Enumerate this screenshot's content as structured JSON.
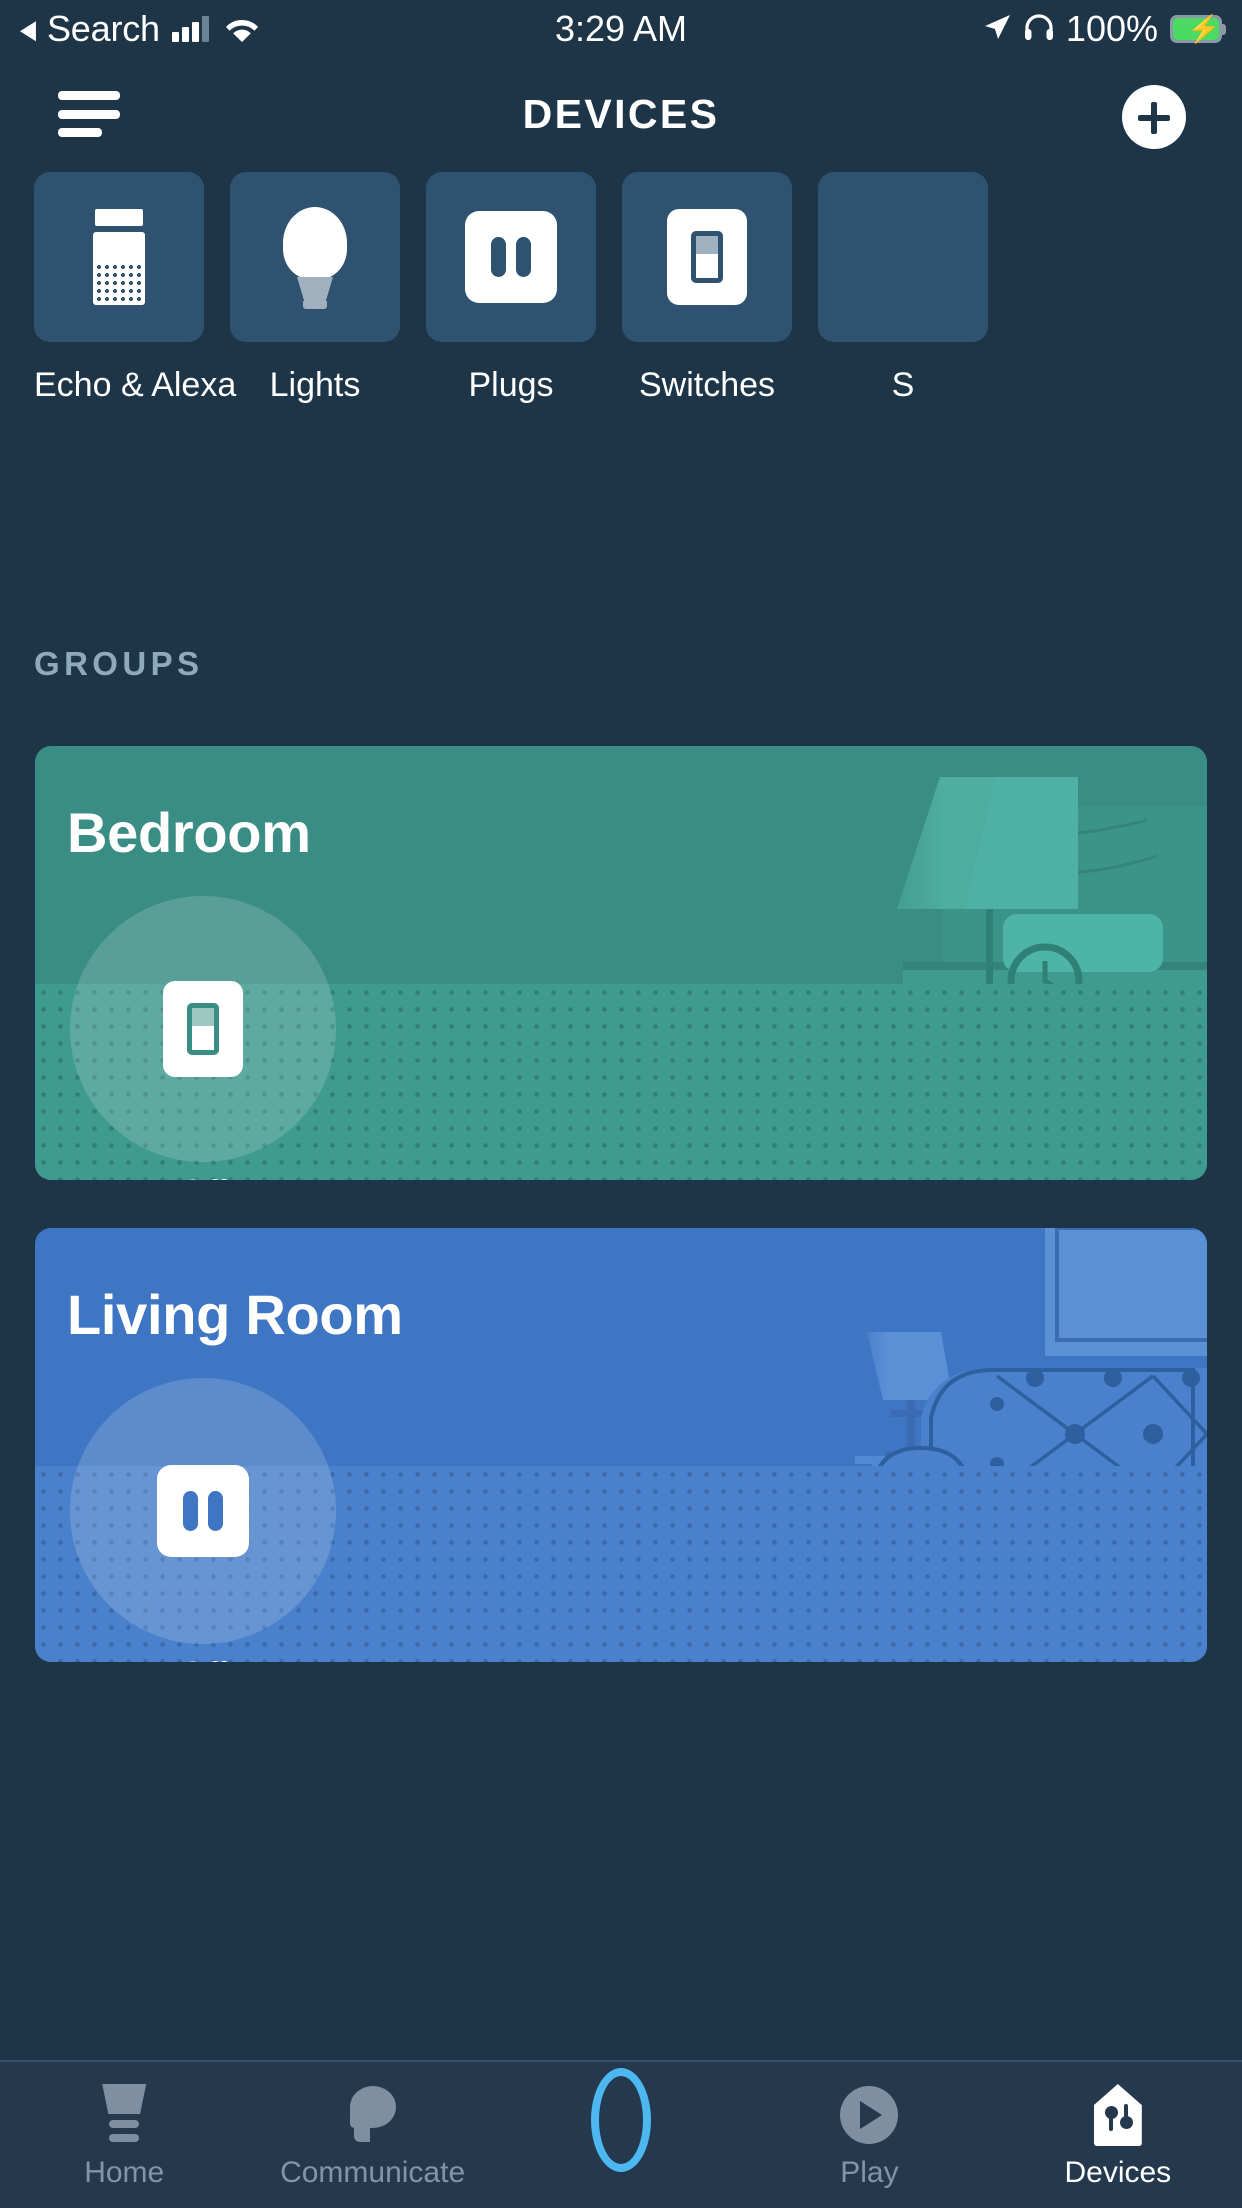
{
  "status_bar": {
    "back_label": "Search",
    "back_arrow_icon": "triangle-left-icon",
    "signal_icon": "cellular-signal-icon",
    "wifi_icon": "wifi-icon",
    "time": "3:29 AM",
    "location_icon": "location-arrow-icon",
    "headphones_icon": "headphones-icon",
    "battery_percent": "100%",
    "battery_icon": "battery-charging-icon",
    "battery_fill_color": "#4cd964"
  },
  "header": {
    "menu_icon": "hamburger-menu-icon",
    "title": "DEVICES",
    "add_icon": "plus-icon"
  },
  "categories": [
    {
      "label": "Echo & Alexa",
      "icon": "echo-speaker-icon"
    },
    {
      "label": "Lights",
      "icon": "light-bulb-icon"
    },
    {
      "label": "Plugs",
      "icon": "plug-outlet-icon"
    },
    {
      "label": "Switches",
      "icon": "wall-switch-icon"
    },
    {
      "label": "S",
      "icon": "partial-card-icon"
    }
  ],
  "groups": {
    "section_title": "GROUPS",
    "cards": [
      {
        "name": "Bedroom",
        "state": "Off",
        "accent": "#3a8d84",
        "toggle_icon": "wall-switch-icon",
        "scene": "bedroom-illustration"
      },
      {
        "name": "Living Room",
        "state": "Off",
        "accent": "#3f76c4",
        "toggle_icon": "plug-outlet-icon",
        "scene": "living-room-illustration"
      }
    ]
  },
  "bottom_nav": {
    "items": [
      {
        "label": "Home",
        "icon": "home-icon",
        "active": false
      },
      {
        "label": "Communicate",
        "icon": "chat-bubble-icon",
        "active": false
      },
      {
        "label": "",
        "icon": "alexa-ring-icon",
        "active": false
      },
      {
        "label": "Play",
        "icon": "play-circle-icon",
        "active": false
      },
      {
        "label": "Devices",
        "icon": "devices-house-icon",
        "active": true
      }
    ]
  },
  "colors": {
    "app_background": "#1e3548",
    "tile_background": "#2f5271",
    "bedroom_green": "#3a8d84",
    "living_room_blue": "#3f76c4",
    "nav_background": "#24394e",
    "alexa_blue": "#4db8f0"
  }
}
